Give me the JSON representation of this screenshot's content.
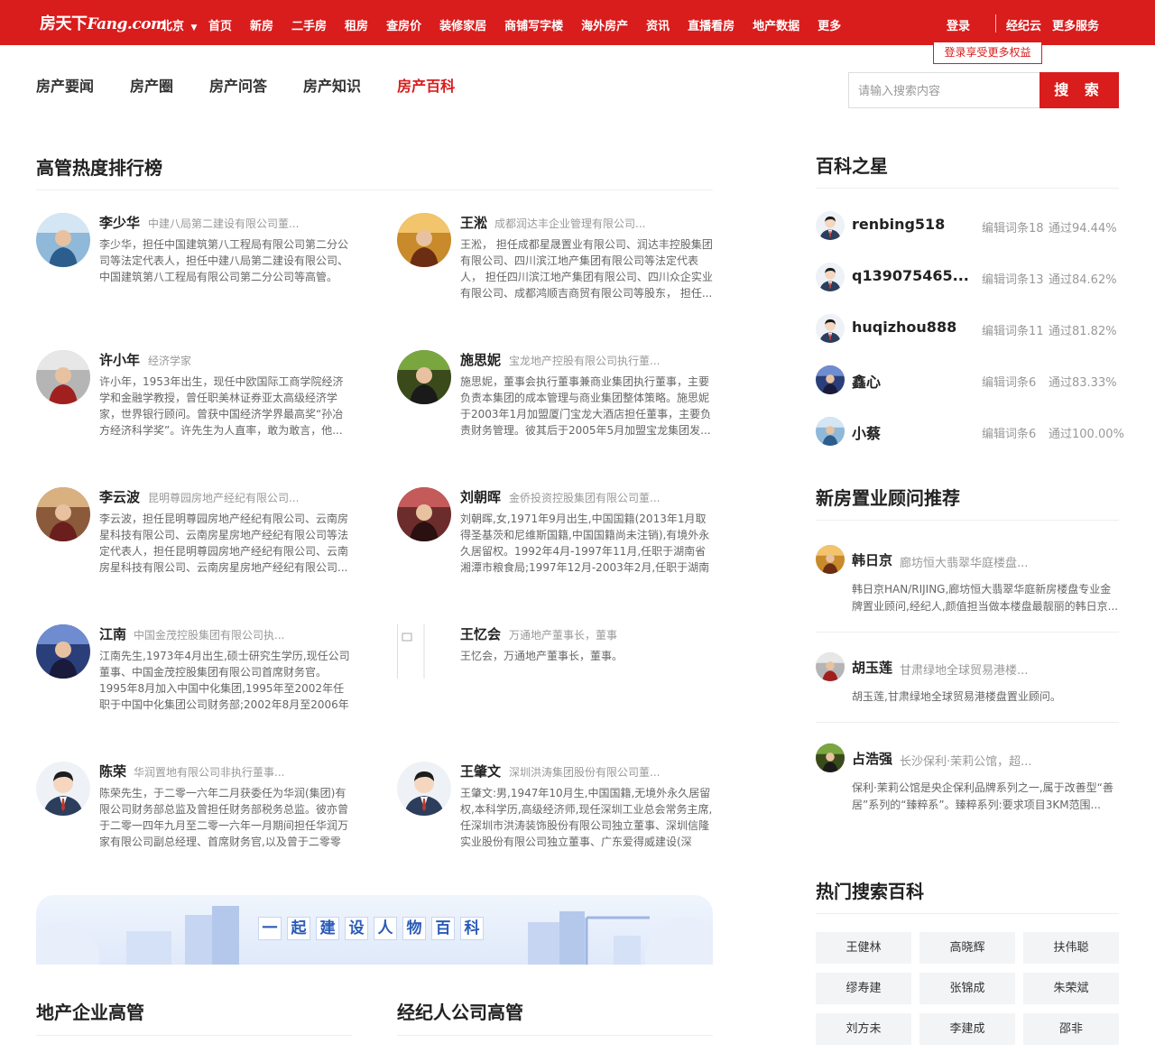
{
  "topbar": {
    "logo_cn": "房天下",
    "logo_en": "Fang.com",
    "city": "北京",
    "nav": [
      "首页",
      "新房",
      "二手房",
      "租房",
      "查房价",
      "装修家居",
      "商铺写字楼",
      "海外房产",
      "资讯",
      "直播看房",
      "地产数据",
      "更多"
    ],
    "login": "登录",
    "login_tip": "登录享受更多权益",
    "right_links": [
      "经纪云",
      "更多服务"
    ]
  },
  "subnav": {
    "items": [
      "房产要闻",
      "房产圈",
      "房产问答",
      "房产知识",
      "房产百科"
    ],
    "active_index": 4
  },
  "search": {
    "placeholder": "请输入搜索内容",
    "button": "搜 索"
  },
  "ranking": {
    "title": "高管热度排行榜",
    "people": [
      {
        "name": "李少华",
        "org": "中建八局第二建设有限公司董...",
        "desc": "李少华，担任中国建筑第八工程局有限公司第二分公司等法定代表人，担任中建八局第二建设有限公司、中国建筑第八工程局有限公司第二分公司等高管。",
        "avatar_icon": "photo-avatar"
      },
      {
        "name": "王淞",
        "org": "成都润达丰企业管理有限公司...",
        "desc": "王淞，  担任成都星晟置业有限公司、润达丰控股集团有限公司、四川滨江地产集团有限公司等法定代表人，  担任四川滨江地产集团有限公司、四川众企实业有限公司、成都鸿顺吉商贸有限公司等股东，  担任...",
        "avatar_icon": "photo-avatar"
      },
      {
        "name": "许小年",
        "org": "经济学家",
        "desc": "许小年，1953年出生，现任中欧国际工商学院经济学和金融学教授，曾任职美林证券亚太高级经济学家，世界银行顾问。曾获中国经济学界最高奖“孙冶方经济科学奖”。许先生为人直率，敢为敢言，他...",
        "avatar_icon": "photo-avatar"
      },
      {
        "name": "施思妮",
        "org": "宝龙地产控股有限公司执行董...",
        "desc": "施思妮，董事会执行董事兼商业集团执行董事，主要负责本集团的成本管理与商业集团整体策略。施思妮于2003年1月加盟厦门宝龙大酒店担任董事，主要负责财务管理。彼其后于2005年5月加盟宝龙集团发...",
        "avatar_icon": "photo-avatar"
      },
      {
        "name": "李云波",
        "org": "昆明尊园房地产经纪有限公司...",
        "desc": "李云波，担任昆明尊园房地产经纪有限公司、云南房星科技有限公司、云南房星房地产经纪有限公司等法定代表人，担任昆明尊园房地产经纪有限公司、云南房星科技有限公司、云南房星房地产经纪有限公司...",
        "avatar_icon": "photo-avatar"
      },
      {
        "name": "刘朝晖",
        "org": "金侨投资控股集团有限公司董...",
        "desc": "刘朝晖,女,1971年9月出生,中国国籍(2013年1月取得圣基茨和尼维斯国籍,中国国籍尚未注销),有境外永久居留权。1992年4月-1997年11月,任职于湖南省湘潭市粮食局;1997年12月-2003年2月,任职于湖南省湘...",
        "avatar_icon": "photo-avatar"
      },
      {
        "name": "江南",
        "org": "中国金茂控股集团有限公司执...",
        "desc": "江南先生,1973年4月出生,硕士研究生学历,现任公司董事、中国金茂控股集团有限公司首席财务官。1995年8月加入中国中化集团,1995年至2002年任职于中国中化集团公司财务部;2002年8月至2006年1...",
        "avatar_icon": "photo-avatar"
      },
      {
        "name": "王忆会",
        "org": "万通地产董事长，董事",
        "desc": "王忆会，万通地产董事长，董事。",
        "avatar_icon": "broken-image-icon"
      },
      {
        "name": "陈荣",
        "org": "华润置地有限公司非执行董事...",
        "desc": "陈荣先生，于二零一六年二月获委任为华润(集团)有限公司财务部总监及曾担任财务部税务总监。彼亦曾于二零一四年九月至二零一六年一月期间担任华润万家有限公司副总经理、首席财务官,以及曾于二零零七...",
        "avatar_icon": "default-user-avatar"
      },
      {
        "name": "王肇文",
        "org": "深圳洪涛集团股份有限公司董...",
        "desc": "王肇文:男,1947年10月生,中国国籍,无境外永久居留权,本科学历,高级经济师,现任深圳工业总会常务主席,任深圳市洪涛装饰股份有限公司独立董事、深圳信隆实业股份有限公司独立董事、广东爱得威建设(深圳...",
        "avatar_icon": "default-user-avatar"
      }
    ]
  },
  "banner": {
    "text_chars": [
      "一",
      "起",
      "建",
      "设",
      "人",
      "物",
      "百",
      "科"
    ]
  },
  "bottom_sections": {
    "developer_execs": "地产企业高管",
    "broker_execs": "经纪人公司高管"
  },
  "stars": {
    "title": "百科之星",
    "items": [
      {
        "name": "renbing518",
        "edits": "编辑词条18",
        "pass": "通过94.44%"
      },
      {
        "name": "q139075465...",
        "edits": "编辑词条13",
        "pass": "通过84.62%"
      },
      {
        "name": "huqizhou888",
        "edits": "编辑词条11",
        "pass": "通过81.82%"
      },
      {
        "name": "鑫心",
        "edits": "编辑词条6",
        "pass": "通过83.33%"
      },
      {
        "name": "小蔡",
        "edits": "编辑词条6",
        "pass": "通过100.00%"
      }
    ]
  },
  "advisors": {
    "title": "新房置业顾问推荐",
    "items": [
      {
        "name": "韩日京",
        "org": "廊坊恒大翡翠华庭楼盘...",
        "desc": "韩日京HAN/RIJING,廊坊恒大翡翠华庭新房楼盘专业金牌置业顾问,经纪人,颜值担当做本楼盘最靓丽的韩日京..."
      },
      {
        "name": "胡玉莲",
        "org": "甘肃绿地全球贸易港楼...",
        "desc": "胡玉莲,甘肃绿地全球贸易港楼盘置业顾问。"
      },
      {
        "name": "占浩强",
        "org": "长沙保利·茉莉公馆，超...",
        "desc": "保利·茉莉公馆是央企保利品牌系列之一,属于改善型“善居”系列的“臻粹系”。臻粹系列:要求项目3KM范围..."
      }
    ]
  },
  "hot_search": {
    "title": "热门搜索百科",
    "tags": [
      "王健林",
      "高晓辉",
      "扶伟聪",
      "缪寿建",
      "张锦成",
      "朱荣斌",
      "刘方未",
      "李建成",
      "邵非"
    ]
  },
  "colors": {
    "brand_red": "#d91c1c",
    "banner_blue": "#2a5bb8"
  }
}
